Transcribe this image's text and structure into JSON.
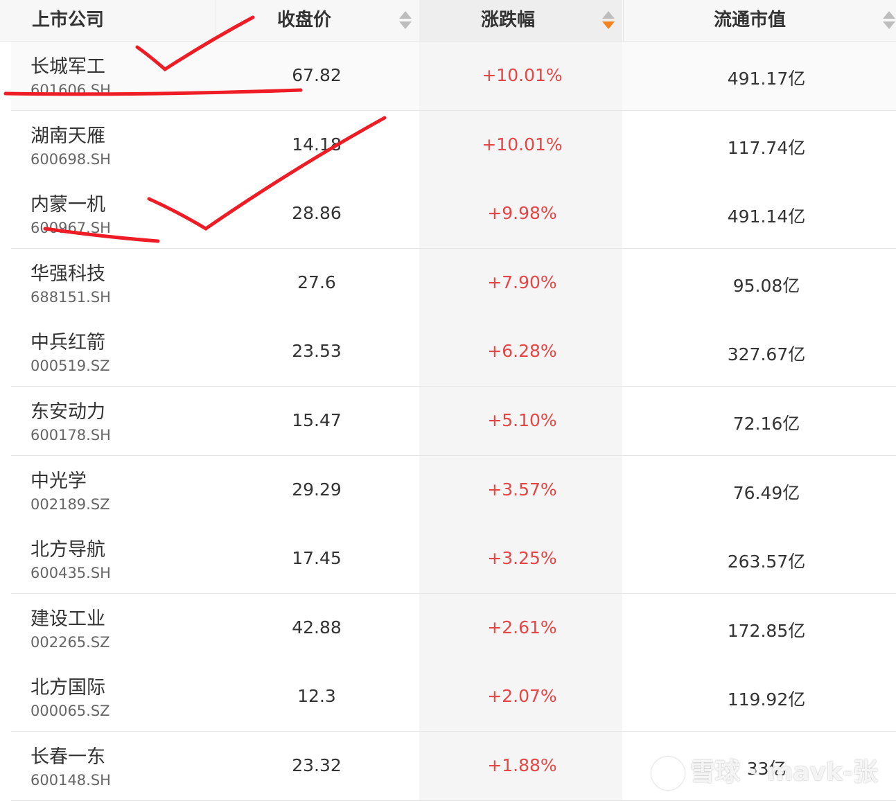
{
  "header": {
    "company": "上市公司",
    "close": "收盘价",
    "change": "涨跌幅",
    "cap": "流通市值"
  },
  "rows": [
    {
      "name": "长城军工",
      "code": "601606.SH",
      "close": "67.82",
      "change": "+10.01%",
      "cap": "491.17亿"
    },
    {
      "name": "湖南天雁",
      "code": "600698.SH",
      "close": "14.18",
      "change": "+10.01%",
      "cap": "117.74亿"
    },
    {
      "name": "内蒙一机",
      "code": "600967.SH",
      "close": "28.86",
      "change": "+9.98%",
      "cap": "491.14亿"
    },
    {
      "name": "华强科技",
      "code": "688151.SH",
      "close": "27.6",
      "change": "+7.90%",
      "cap": "95.08亿"
    },
    {
      "name": "中兵红箭",
      "code": "000519.SZ",
      "close": "23.53",
      "change": "+6.28%",
      "cap": "327.67亿"
    },
    {
      "name": "东安动力",
      "code": "600178.SH",
      "close": "15.47",
      "change": "+5.10%",
      "cap": "72.16亿"
    },
    {
      "name": "中光学",
      "code": "002189.SZ",
      "close": "29.29",
      "change": "+3.57%",
      "cap": "76.49亿"
    },
    {
      "name": "北方导航",
      "code": "600435.SH",
      "close": "17.45",
      "change": "+3.25%",
      "cap": "263.57亿"
    },
    {
      "name": "建设工业",
      "code": "002265.SZ",
      "close": "42.88",
      "change": "+2.61%",
      "cap": "172.85亿"
    },
    {
      "name": "北方国际",
      "code": "000065.SZ",
      "close": "12.3",
      "change": "+2.07%",
      "cap": "119.92亿"
    },
    {
      "name": "长春一东",
      "code": "600148.SH",
      "close": "23.32",
      "change": "+1.88%",
      "cap": "33亿"
    }
  ],
  "watermark": "雪球 · mavk-张",
  "colors": {
    "up": "#e64545",
    "sort_active": "#f5821f",
    "annotation": "#ee1c25"
  }
}
